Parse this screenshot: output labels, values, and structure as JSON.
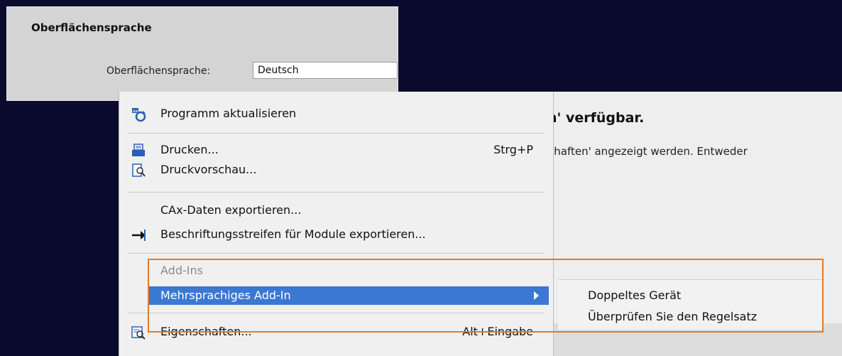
{
  "settings": {
    "section_title": "Oberflächensprache",
    "language_label": "Oberflächensprache:",
    "language_value": "Deutsch"
  },
  "background": {
    "heading": "n' verfügbar.",
    "text": "chaften' angezeigt werden. Entweder"
  },
  "context_menu": {
    "items": [
      {
        "label": "Programm aktualisieren",
        "icon": "refresh-program-icon"
      },
      {
        "label": "Drucken...",
        "shortcut": "Strg+P",
        "icon": "print-icon"
      },
      {
        "label": "Druckvorschau...",
        "icon": "print-preview-icon"
      },
      {
        "label": "CAx-Daten exportieren..."
      },
      {
        "label": "Beschriftungsstreifen für Module exportieren...",
        "icon": "export-arrow-icon"
      },
      {
        "label": "Add-Ins",
        "disabled": true
      },
      {
        "label": "Mehrsprachiges Add-In",
        "highlighted": true,
        "submenu": true
      },
      {
        "label": "Eigenschaften...",
        "shortcut": "Alt+Eingabe",
        "icon": "properties-icon"
      }
    ]
  },
  "submenu": {
    "items": [
      {
        "label": "Doppeltes Gerät"
      },
      {
        "label": "Überprüfen Sie den Regelsatz"
      }
    ]
  },
  "colors": {
    "highlight": "#3a78d2",
    "annotation_box": "#e07a28",
    "background": "#0b0b2e"
  }
}
